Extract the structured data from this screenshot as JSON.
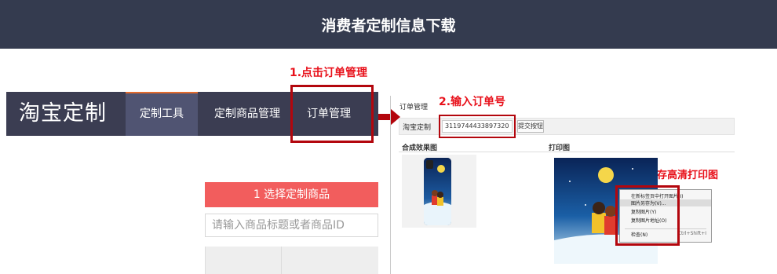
{
  "page": {
    "title": "消费者定制信息下载"
  },
  "steps": {
    "step1": "1.点击订单管理",
    "step2": "2.输入订单号",
    "step3": "3.右键另存高清打印图"
  },
  "taobao": {
    "logo": "淘宝定制",
    "tabs": [
      "定制工具",
      "定制商品管理",
      "订单管理"
    ],
    "active_tab": 0,
    "select_product_button": "1 选择定制商品",
    "search_placeholder": "请输入商品标题或者商品ID"
  },
  "order_panel": {
    "title": "订单管理",
    "row_label": "淘宝定制",
    "order_number": "3119744433897320",
    "submit_button": "提交按钮",
    "composite_heading": "合成效果图",
    "print_heading": "打印图"
  },
  "context_menu": {
    "items": [
      "在新标签页中打开图片(I)",
      "图片另存为(V)...",
      "复制图片(Y)",
      "复制图片地址(O)",
      "检查(N)"
    ],
    "highlighted_index": 1,
    "inspect_shortcut": "Ctrl+Shift+I"
  },
  "colors": {
    "title_bar": "#343b4f",
    "nav_bg": "#3b3d52",
    "annotation_red": "#e8101a",
    "select_button": "#f25d5d"
  },
  "icons": {
    "arrow": "right-arrow-icon"
  }
}
